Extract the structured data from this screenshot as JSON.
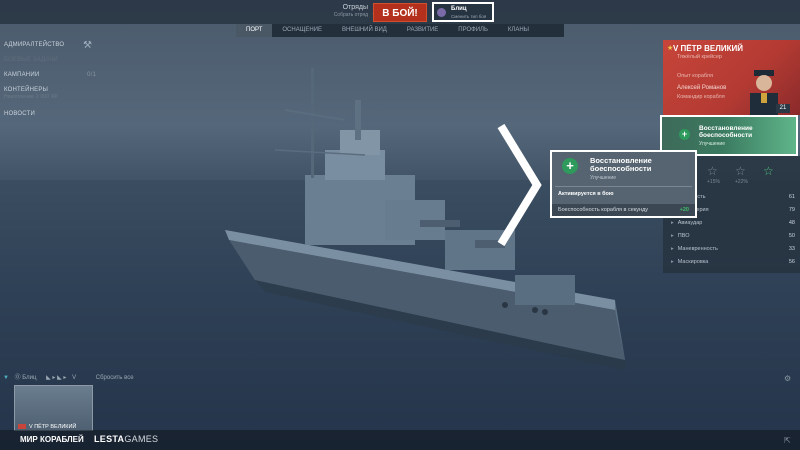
{
  "header": {
    "squad_label": "Отряды",
    "squad_sub": "Собрать отряд",
    "battle_button": "В БОЙ!",
    "mode_title": "Блиц",
    "mode_sub": "Сменить тип боя"
  },
  "tabs": [
    "ПОРТ",
    "ОСНАЩЕНИЕ",
    "ВНЕШНИЙ ВИД",
    "РАЗВИТИЕ",
    "ПРОФИЛЬ",
    "КЛАНЫ"
  ],
  "left_panel": {
    "admiralty": "АДМИРАЛТЕЙСТВО",
    "combat_missions": "БОЕВЫЕ ЗАДАЧИ",
    "campaigns": "КАМПАНИИ",
    "campaigns_count": "0/1",
    "containers": "КОНТЕЙНЕРЫ",
    "containers_sub": "Накопление 2 000 XP",
    "news": "НОВОСТИ"
  },
  "ship_panel": {
    "ship_name": "V ПЁТР ВЕЛИКИЙ",
    "line1": "Тяжёлый крейсер",
    "line2": "Опыт корабля",
    "commander": "Алексей Романов",
    "commander_sub": "Командир корабля",
    "level": "21"
  },
  "skill_card_small": {
    "title_line1": "Восстановление",
    "title_line2": "боеспособности",
    "type": "Улучшение"
  },
  "skill_card_big": {
    "title_line1": "Восстановление",
    "title_line2": "боеспособности",
    "type": "Улучшение",
    "note": "Активируется в бою",
    "effect": "Боеспособность корабля в секунду",
    "effect_value": "+20"
  },
  "stats": [
    {
      "label": "Живучесть",
      "value": "61"
    },
    {
      "label": "Артиллерия",
      "value": "79"
    },
    {
      "label": "Авиаудар",
      "value": "48"
    },
    {
      "label": "ПВО",
      "value": "50"
    },
    {
      "label": "Маневренность",
      "value": "33"
    },
    {
      "label": "Маскировка",
      "value": "56"
    }
  ],
  "star_percents": [
    "+15%",
    "+22%"
  ],
  "bottom": {
    "filter_mode": "Блиц",
    "filter_tier": "V",
    "reset": "Сбросить все",
    "thumb_name": "V ПЁТР ВЕЛИКИЙ",
    "logo_left": "МИР КОРАБЛЕЙ",
    "logo_right_bold": "LESTA",
    "logo_right_light": "GAMES"
  },
  "colors": {
    "battle_button": "#b3311c",
    "skill_green": "#2e9a5c",
    "flag_red": "#c7453a",
    "effect_value": "#3fbf6a"
  }
}
